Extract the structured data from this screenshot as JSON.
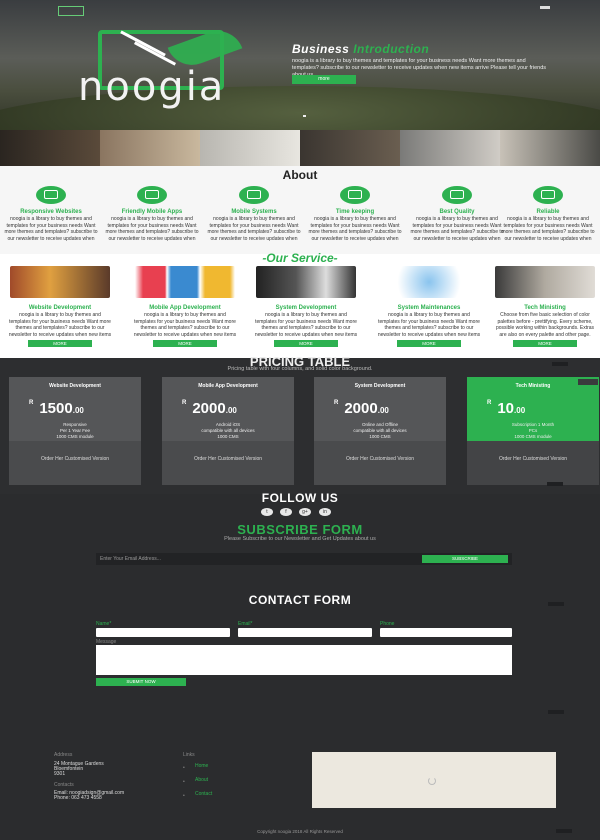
{
  "header": {
    "logo_text": "noogia",
    "intro_title_plain": "Business ",
    "intro_title_accent": "Introduction",
    "intro_text": "noogia is a library to buy themes and templates for your business needs Want more themes and templates? subscribe to our newsletter to receive updates when new items arrive Please tell your friends about us",
    "intro_button": "more"
  },
  "about": {
    "title": "About",
    "features": [
      {
        "title": "Responsive Websites",
        "icon": "laptop-icon",
        "text": "noogia is a library to buy themes and templates for your business needs Want more themes and templates? subscribe to our newsletter to receive updates when new items arrive"
      },
      {
        "title": "Friendly Mobile Apps",
        "icon": "users-icon",
        "text": "noogia is a library to buy themes and templates for your business needs Want more themes and templates? subscribe to our newsletter to receive updates when new items arrive"
      },
      {
        "title": "Mobile Systems",
        "icon": "monitor-icon",
        "text": "noogia is a library to buy themes and templates for your business needs Want more themes and templates? subscribe to our newsletter to receive updates when new items arrive"
      },
      {
        "title": "Time keeping",
        "icon": "clock-icon",
        "text": "noogia is a library to buy themes and templates for your business needs Want more themes and templates? subscribe to our newsletter to receive updates when new items arrive"
      },
      {
        "title": "Best Quality",
        "icon": "check-icon",
        "text": "noogia is a library to buy themes and templates for your business needs Want more themes and templates? subscribe to our newsletter to receive updates when new items arrive"
      },
      {
        "title": "Reliable",
        "icon": "box-icon",
        "text": "noogia is a library to buy themes and templates for your business needs Want more themes and templates? subscribe to our newsletter to receive updates when new items arrive"
      }
    ]
  },
  "services": {
    "title": "-Our Service-",
    "items": [
      {
        "title": "Website Development",
        "text": "noogia is a library to buy themes and templates for your business needs Want more themes and templates? subscribe to our newsletter to receive updates when new items arrive.",
        "button": "MORE"
      },
      {
        "title": "Mobile App Development",
        "text": "noogia is a library to buy themes and templates for your business needs Want more themes and templates? subscribe to our newsletter to receive updates when new items arrive.",
        "button": "MORE"
      },
      {
        "title": "System Development",
        "text": "noogia is a library to buy themes and templates for your business needs Want more themes and templates? subscribe to our newsletter to receive updates when new items arrive.",
        "button": "MORE"
      },
      {
        "title": "System Maintenances",
        "text": "noogia is a library to buy themes and templates for your business needs Want more themes and templates? subscribe to our newsletter to receive updates when new items arrive.",
        "button": "MORE"
      },
      {
        "title": "Tech Ministing",
        "text": "Choose from five basic selection of color palettes before - prettifying. Every scheme, possible working within backgrounds. Extras are also on every palette and other page.",
        "button": "MORE"
      }
    ]
  },
  "pricing": {
    "title": "PRICING TABLE",
    "subtitle": "Pricing table with four columns, and solid color background.",
    "plans": [
      {
        "name": "Website Development",
        "currency": "R",
        "amount": "1500",
        "cents": ".00",
        "features": [
          "Responsive",
          "Per 1 Year Fee",
          "1000 CMS module",
          "vat"
        ],
        "footer": "Order Her Customised Version",
        "highlight": false
      },
      {
        "name": "Mobile App Development",
        "currency": "R",
        "amount": "2000",
        "cents": ".00",
        "features": [
          "Android iOS",
          "compatible with all devices",
          "1000 CMS",
          "vat"
        ],
        "footer": "Order Her Customised Version",
        "highlight": false
      },
      {
        "name": "System Development",
        "currency": "R",
        "amount": "2000",
        "cents": ".00",
        "features": [
          "Online and Offline",
          "compatible with all devices",
          "1000 CMS",
          "vat"
        ],
        "footer": "Order Her Customised Version",
        "highlight": false
      },
      {
        "name": "Tech Ministing",
        "currency": "R",
        "amount": "10",
        "cents": ".00",
        "features": [
          "Subscription 1 Month",
          "PCs",
          "1000 CMS module",
          "vat"
        ],
        "footer": "Order Her Customised Version",
        "highlight": true
      }
    ]
  },
  "follow": {
    "title": "FOLLOW US",
    "socials": [
      "t",
      "f",
      "g+",
      "in"
    ]
  },
  "subscribe": {
    "title": "SUBSCRIBE FORM",
    "text": "Please Subscribe to our Newsletter and Get Updates about us",
    "placeholder": "Enter Your Email Address...",
    "button": "SUBSCRIBE"
  },
  "contact": {
    "title": "CONTACT FORM",
    "name_label": "Name*",
    "email_label": "Email*",
    "phone_label": "Phone",
    "message_label": "Message",
    "submit": "SUBMIT NOW"
  },
  "footer": {
    "address_label": "Address",
    "address_lines": [
      "24 Montague Gardens",
      "Bloemfontein",
      "9301"
    ],
    "contacts_label": "Contacts",
    "contacts_lines": [
      "Email: noogiadsign@gmail.com",
      "Phone: 063 473 4558"
    ],
    "links_label": "Links",
    "links": [
      "Home",
      "About",
      "Contact"
    ],
    "copyright": "Copyright noogia 2018 All Rights Reserved"
  },
  "colors": {
    "accent": "#2db150",
    "dark_bg": "#2b2c2e",
    "card_bg": "#555658"
  }
}
